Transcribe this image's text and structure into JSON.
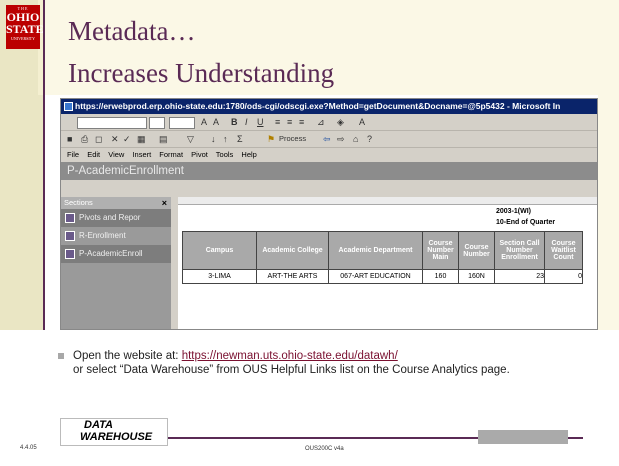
{
  "slide": {
    "title_line1": "Metadata…",
    "title_line2": "Increases Understanding",
    "logo": {
      "line1": "THE",
      "line2": "OHIO",
      "line3": "STATE",
      "line4": "UNIVERSITY"
    }
  },
  "browser": {
    "title_bar": "https://erwebprod.erp.ohio-state.edu:1780/ods-cgi/odscgi.exe?Method=getDocument&Docname=@5p5432 - Microsoft In",
    "process_label": "Process",
    "menu": [
      "File",
      "Edit",
      "View",
      "Insert",
      "Format",
      "Pivot",
      "Tools",
      "Help"
    ],
    "doc_title": "P-AcademicEnrollment"
  },
  "sections_panel": {
    "header": "Sections",
    "close": "×",
    "items": [
      "Pivots and Repor",
      "R-Enrollment",
      "P-AcademicEnroll"
    ]
  },
  "grid": {
    "term": "2003-1(WI)",
    "quarter": "10-End of Quarter",
    "columns": [
      "Campus",
      "Academic College",
      "Academic Department",
      "Course Number Main",
      "Course Number",
      "Section Call Number Enrollment",
      "Course Waitlist Count"
    ],
    "row": [
      "3-LIMA",
      "ART-THE ARTS",
      "067-ART EDUCATION",
      "160",
      "160N",
      "23",
      "0"
    ]
  },
  "bullet": {
    "prefix": "Open the website at: ",
    "link": "https://newman.uts.ohio-state.edu/datawh/",
    "rest": "or select  “Data Warehouse” from OUS Helpful Links list on the Course Analytics page."
  },
  "footer": {
    "date": "4.4.05",
    "course_code": "OUS200C v4a",
    "logo_line1": "DATA",
    "logo_line2": "WAREHOUSE"
  },
  "colors": {
    "accent": "#5a2a55",
    "osu_red": "#bb0000",
    "link": "#7a1030"
  }
}
